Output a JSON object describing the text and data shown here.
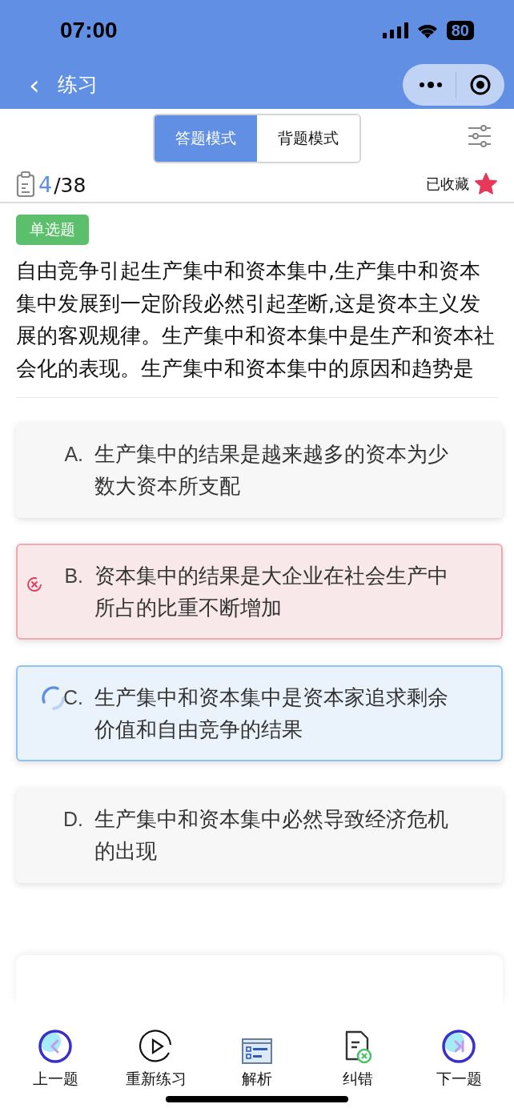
{
  "status_bar": {
    "time": "07:00",
    "battery": "80"
  },
  "nav": {
    "back": "‹",
    "title": "练习"
  },
  "mode_tabs": [
    {
      "label": "答题模式",
      "selected": true
    },
    {
      "label": "背题模式",
      "selected": false
    }
  ],
  "progress": {
    "current": "4",
    "total": "/38"
  },
  "favorite": {
    "label": "已收藏",
    "on": true
  },
  "question": {
    "type": "单选题",
    "text": "自由竞争引起生产集中和资本集中,生产集中和资本集中发展到一定阶段必然引起垄断,这是资本主义发展的客观规律。生产集中和资本集中是生产和资本社会化的表现。生产集中和资本集中的原因和趋势是"
  },
  "options": [
    {
      "letter": "A.",
      "text": "生产集中的结果是越来越多的资本为少数大资本所支配",
      "selected": false,
      "wrong": false
    },
    {
      "letter": "B.",
      "text": "资本集中的结果是大企业在社会生产中所占的比重不断增加",
      "selected": false,
      "wrong": true
    },
    {
      "letter": "C.",
      "text": "生产集中和资本集中是资本家追求剩余价值和自由竞争的结果",
      "selected": true,
      "wrong": false
    },
    {
      "letter": "D.",
      "text": "生产集中和资本集中必然导致经济危机的出现",
      "selected": false,
      "wrong": false
    }
  ],
  "bottom_bar": [
    {
      "kind": "prev",
      "label": "上一题"
    },
    {
      "kind": "restart",
      "label": "重新练习"
    },
    {
      "kind": "analysis",
      "label": "解析"
    },
    {
      "kind": "report",
      "label": "纠错"
    },
    {
      "kind": "next",
      "label": "下一题"
    }
  ]
}
